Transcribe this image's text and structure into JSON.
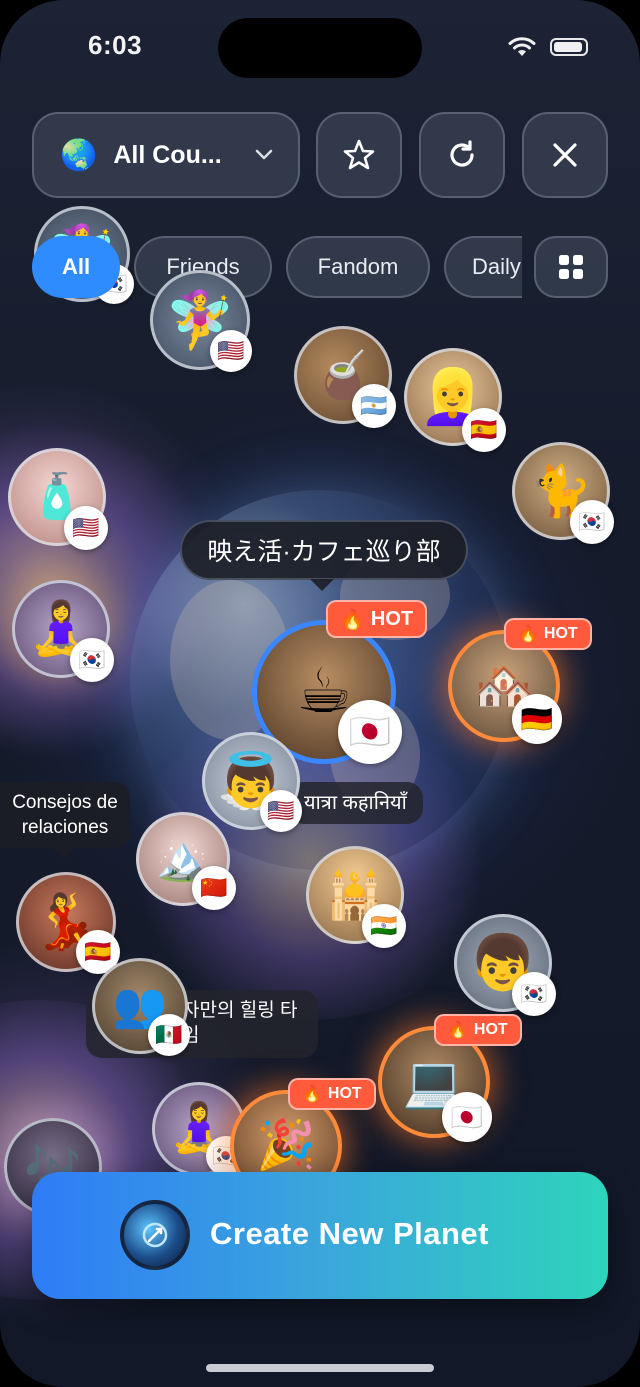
{
  "status": {
    "time": "6:03"
  },
  "header": {
    "country_filter": {
      "icon": "globe-icon",
      "label": "All Cou..."
    },
    "favorite_icon": "star-icon",
    "refresh_icon": "refresh-icon",
    "close_icon": "close-icon"
  },
  "tabs": [
    {
      "label": "All",
      "active": true
    },
    {
      "label": "Friends",
      "active": false
    },
    {
      "label": "Fandom",
      "active": false
    },
    {
      "label": "Daily",
      "active": false
    }
  ],
  "grid_icon": "grid-icon",
  "tooltips": {
    "featured": "映え活·カフェ巡り部",
    "relationships": "Consejos de\nrelaciones",
    "travel_hindi": "यात्रा कहानियाँ",
    "healing_korean": "자만의 힐링 타\n임"
  },
  "hot_label": "HOT",
  "hot_icon": "fire-icon",
  "planets": [
    {
      "subject": "fairy",
      "flag": "🇰🇷"
    },
    {
      "subject": "fairy",
      "flag": "🇺🇸"
    },
    {
      "subject": "mate-drink",
      "flag": "🇦🇷"
    },
    {
      "subject": "blonde-woman",
      "flag": "🇪🇸"
    },
    {
      "subject": "cat",
      "flag": "🇰🇷"
    },
    {
      "subject": "perfume",
      "flag": "🇺🇸"
    },
    {
      "subject": "yoga",
      "flag": "🇰🇷"
    },
    {
      "subject": "cafe-group",
      "flag": "🇯🇵",
      "hot": true
    },
    {
      "subject": "old-town",
      "flag": "🇩🇪",
      "hot": true
    },
    {
      "subject": "baby-angel",
      "flag": "🇺🇸"
    },
    {
      "subject": "snow-landscape",
      "flag": "🇨🇳"
    },
    {
      "subject": "taj-mahal",
      "flag": "🇮🇳"
    },
    {
      "subject": "woman-red-dress",
      "flag": "🇪🇸"
    },
    {
      "subject": "street-crowd",
      "flag": "🇲🇽"
    },
    {
      "subject": "painter-boy",
      "flag": "🇰🇷"
    },
    {
      "subject": "desk-study",
      "flag": "🇯🇵",
      "hot": true
    },
    {
      "subject": "yoga",
      "flag": "🇰🇷"
    },
    {
      "subject": "festival-crowd",
      "flag": "",
      "hot": true
    },
    {
      "subject": "party-crowd",
      "flag": ""
    }
  ],
  "create_button": {
    "label": "Create New Planet",
    "icon": "rocket-planet-icon"
  }
}
